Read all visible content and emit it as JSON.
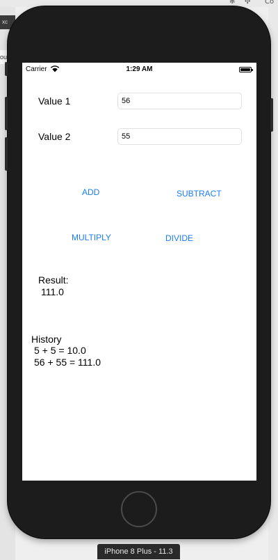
{
  "host": {
    "left_tab_1": "xc",
    "left_tab_2": "ou",
    "tray_right": "Co"
  },
  "status_bar": {
    "carrier": "Carrier",
    "time": "1:29 AM"
  },
  "form": {
    "value1_label": "Value 1",
    "value1_value": "56",
    "value2_label": "Value 2",
    "value2_value": "55"
  },
  "buttons": {
    "add": "ADD",
    "subtract": "SUBTRACT",
    "multiply": "MULTIPLY",
    "divide": "DIVIDE"
  },
  "result": {
    "label": "Result:",
    "value": "111.0"
  },
  "history": {
    "label": "History",
    "entries": [
      "5 + 5 = 10.0",
      "56 + 55 = 111.0"
    ]
  },
  "simulator": {
    "device_name": "iPhone 8 Plus - 11.3"
  },
  "colors": {
    "button_text": "#1a7cf5",
    "device_frame": "#1c1c1c",
    "screen_bg": "#ffffff"
  }
}
